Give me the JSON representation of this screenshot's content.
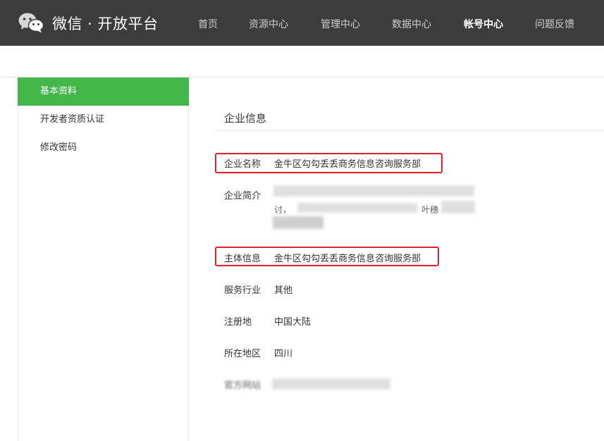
{
  "header": {
    "brand": "微信 · 开放平台",
    "nav": [
      {
        "label": "首页"
      },
      {
        "label": "资源中心"
      },
      {
        "label": "管理中心"
      },
      {
        "label": "数据中心"
      },
      {
        "label": "帐号中心",
        "active": true
      },
      {
        "label": "问题反馈"
      }
    ],
    "colors": {
      "bar": "#3c3c3c",
      "accent": "#44b549",
      "highlight": "#e0202a"
    }
  },
  "sidebar": {
    "items": [
      {
        "label": "基本资料",
        "active": true
      },
      {
        "label": "开发者资质认证"
      },
      {
        "label": "修改密码"
      }
    ]
  },
  "main": {
    "section_title": "企业信息",
    "fields": {
      "company_name": {
        "label": "企业名称",
        "value": "金牛区勾勾丢丢商务信息咨询服务部"
      },
      "company_intro": {
        "label": "企业简介",
        "value_fragment": "讨，",
        "value_fragment2": "叶穗"
      },
      "subject": {
        "label": "主体信息",
        "value": "金牛区勾勾丢丢商务信息咨询服务部"
      },
      "industry": {
        "label": "服务行业",
        "value": "其他"
      },
      "registered": {
        "label": "注册地",
        "value": "中国大陆"
      },
      "region": {
        "label": "所在地区",
        "value": "四川"
      },
      "website": {
        "label": "官方网站"
      }
    }
  }
}
